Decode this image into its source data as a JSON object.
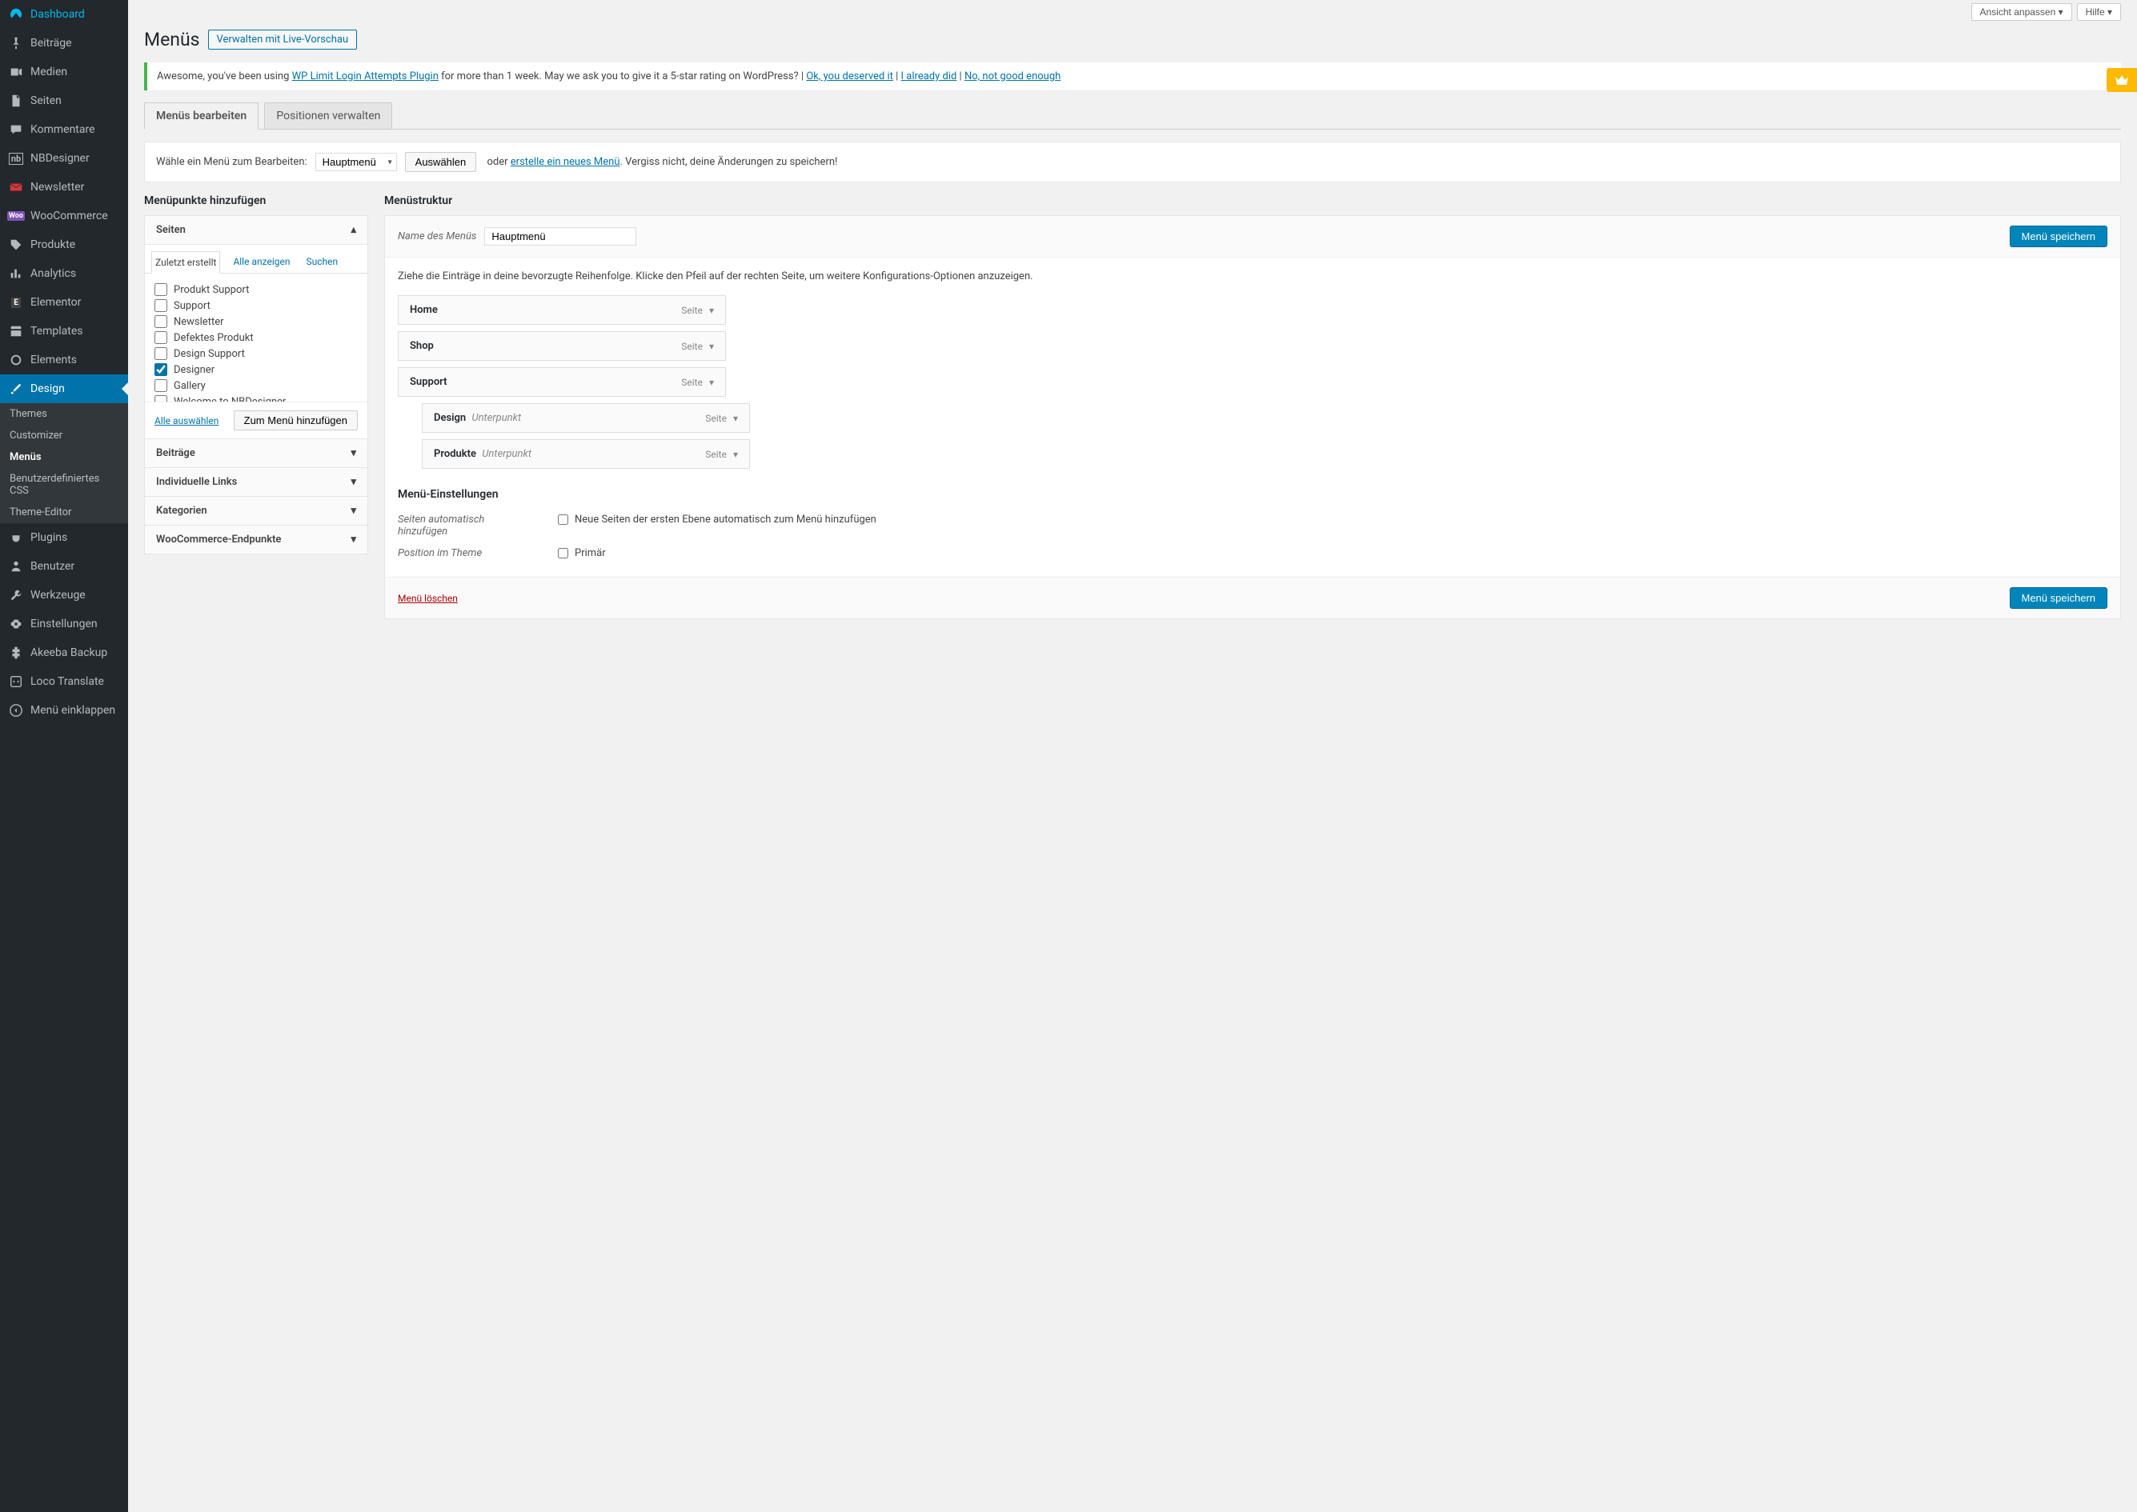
{
  "topbar": {
    "screen_options": "Ansicht anpassen",
    "help": "Hilfe"
  },
  "header": {
    "title": "Menüs",
    "live_preview": "Verwalten mit Live-Vorschau"
  },
  "notice": {
    "pre": "Awesome, you've been using ",
    "plugin": "WP Limit Login Attempts Plugin",
    "post": " for more than 1 week. May we ask you to give it a 5-star rating on WordPress? | ",
    "link1": "Ok, you deserved it",
    "sep": " | ",
    "link2": "I already did",
    "link3": "No, not good enough"
  },
  "tabs": {
    "edit": "Menüs bearbeiten",
    "locations": "Positionen verwalten"
  },
  "manage": {
    "label": "Wähle ein Menü zum Bearbeiten:",
    "selected": "Hauptmenü",
    "select_btn": "Auswählen",
    "or": "oder",
    "create_link": "erstelle ein neues Menü",
    "reminder": ". Vergiss nicht, deine Änderungen zu speichern!"
  },
  "left": {
    "title": "Menüpunkte hinzufügen",
    "acc_pages": "Seiten",
    "acc_posts": "Beiträge",
    "acc_links": "Individuelle Links",
    "acc_cats": "Kategorien",
    "acc_woo": "WooCommerce-Endpunkte",
    "tabs": {
      "recent": "Zuletzt erstellt",
      "all": "Alle anzeigen",
      "search": "Suchen"
    },
    "items": [
      {
        "label": "Produkt Support",
        "checked": false
      },
      {
        "label": "Support",
        "checked": false
      },
      {
        "label": "Newsletter",
        "checked": false
      },
      {
        "label": "Defektes Produkt",
        "checked": false
      },
      {
        "label": "Design Support",
        "checked": false
      },
      {
        "label": "Designer",
        "checked": true
      },
      {
        "label": "Gallery",
        "checked": false
      },
      {
        "label": "Welcome to NBDesigner",
        "checked": false
      }
    ],
    "select_all": "Alle auswählen",
    "add_btn": "Zum Menü hinzufügen"
  },
  "right": {
    "title": "Menüstruktur",
    "name_label": "Name des Menüs",
    "name_value": "Hauptmenü",
    "save": "Menü speichern",
    "hint": "Ziehe die Einträge in deine bevorzugte Reihenfolge. Klicke den Pfeil auf der rechten Seite, um weitere Konfigurations-Optionen anzuzeigen.",
    "type_page": "Seite",
    "subpoint": "Unterpunkt",
    "items": [
      {
        "label": "Home",
        "sub": false
      },
      {
        "label": "Shop",
        "sub": false
      },
      {
        "label": "Support",
        "sub": false
      },
      {
        "label": "Design",
        "sub": true
      },
      {
        "label": "Produkte",
        "sub": true
      }
    ],
    "settings_title": "Menü-Einstellungen",
    "auto_label": "Seiten automatisch hinzufügen",
    "auto_opt": "Neue Seiten der ersten Ebene automatisch zum Menü hinzufügen",
    "loc_label": "Position im Theme",
    "loc_opt": "Primär",
    "delete": "Menü löschen"
  },
  "sidebar": [
    {
      "label": "Dashboard",
      "icon": "dashboard"
    },
    {
      "label": "Beiträge",
      "icon": "pin"
    },
    {
      "label": "Medien",
      "icon": "media"
    },
    {
      "label": "Seiten",
      "icon": "page"
    },
    {
      "label": "Kommentare",
      "icon": "comment"
    },
    {
      "label": "NBDesigner",
      "icon": "nb"
    },
    {
      "label": "Newsletter",
      "icon": "newsletter"
    },
    {
      "label": "WooCommerce",
      "icon": "woo"
    },
    {
      "label": "Produkte",
      "icon": "product"
    },
    {
      "label": "Analytics",
      "icon": "analytics"
    },
    {
      "label": "Elementor",
      "icon": "elementor"
    },
    {
      "label": "Templates",
      "icon": "templates"
    },
    {
      "label": "Elements",
      "icon": "elements"
    },
    {
      "label": "Design",
      "icon": "brush",
      "current": true
    },
    {
      "label": "Plugins",
      "icon": "plugin"
    },
    {
      "label": "Benutzer",
      "icon": "user"
    },
    {
      "label": "Werkzeuge",
      "icon": "tools"
    },
    {
      "label": "Einstellungen",
      "icon": "settings"
    },
    {
      "label": "Akeeba Backup",
      "icon": "akeeba"
    },
    {
      "label": "Loco Translate",
      "icon": "loco"
    },
    {
      "label": "Menü einklappen",
      "icon": "collapse"
    }
  ],
  "sidebar_sub": [
    {
      "label": "Themes"
    },
    {
      "label": "Customizer"
    },
    {
      "label": "Menüs",
      "current": true
    },
    {
      "label": "Benutzerdefiniertes CSS"
    },
    {
      "label": "Theme-Editor"
    }
  ]
}
